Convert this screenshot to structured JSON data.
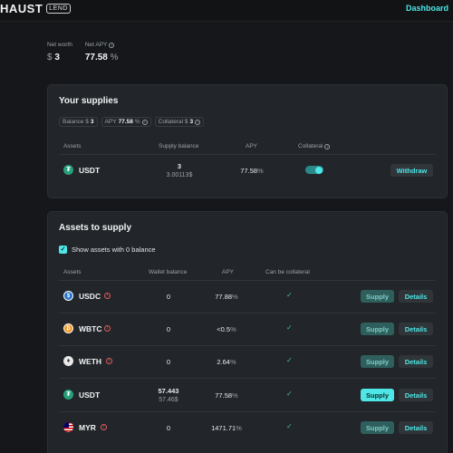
{
  "header": {
    "logo": "HAUST",
    "logo_badge": "LEND",
    "nav_dashboard": "Dashboard"
  },
  "stats": {
    "net_worth_label": "Net worth",
    "net_worth_currency": "$",
    "net_worth_value": "3",
    "net_apy_label": "Net APY",
    "net_apy_value": "77.58",
    "net_apy_unit": "%"
  },
  "supplies": {
    "title": "Your supplies",
    "chips": {
      "balance_label": "Balance $",
      "balance_value": "3",
      "apy_label": "APY",
      "apy_value": "77.58",
      "apy_unit": "%",
      "collateral_label": "Collateral $",
      "collateral_value": "3"
    },
    "columns": [
      "Assets",
      "Supply balance",
      "APY",
      "Collateral"
    ],
    "rows": [
      {
        "symbol": "USDT",
        "balance": "3",
        "balance_usd": "3.00113$",
        "apy": "77.58",
        "apy_unit": "%",
        "collateral_on": true,
        "action": "Withdraw"
      }
    ]
  },
  "assets": {
    "title": "Assets to supply",
    "show_zero_label": "Show assets with 0 balance",
    "show_zero_checked": true,
    "columns": [
      "Assets",
      "Wallet balance",
      "APY",
      "Can be collateral"
    ],
    "rows": [
      {
        "symbol": "USDC",
        "icon": "usdc-icon",
        "color": "#2775ca",
        "warn": true,
        "balance": "0",
        "balance_usd": "",
        "apy": "77.88",
        "apy_unit": "%",
        "supply": "Supply",
        "details": "Details",
        "supply_enabled": false
      },
      {
        "symbol": "WBTC",
        "icon": "wbtc-icon",
        "color": "#f7931a",
        "warn": true,
        "balance": "0",
        "balance_usd": "",
        "apy": "<0.5",
        "apy_unit": "%",
        "supply": "Supply",
        "details": "Details",
        "supply_enabled": false
      },
      {
        "symbol": "WETH",
        "icon": "weth-icon",
        "color": "#e8e8e8",
        "warn": true,
        "balance": "0",
        "balance_usd": "",
        "apy": "2.64",
        "apy_unit": "%",
        "supply": "Supply",
        "details": "Details",
        "supply_enabled": false
      },
      {
        "symbol": "USDT",
        "icon": "usdt-icon",
        "color": "#26a17b",
        "warn": false,
        "balance": "57.443",
        "balance_usd": "57.46$",
        "apy": "77.58",
        "apy_unit": "%",
        "supply": "Supply",
        "details": "Details",
        "supply_enabled": true
      },
      {
        "symbol": "MYR",
        "icon": "myr-flag-icon",
        "color": "#cc0001",
        "warn": true,
        "balance": "0",
        "balance_usd": "",
        "apy": "1471.71",
        "apy_unit": "%",
        "supply": "Supply",
        "details": "Details",
        "supply_enabled": false
      }
    ]
  }
}
